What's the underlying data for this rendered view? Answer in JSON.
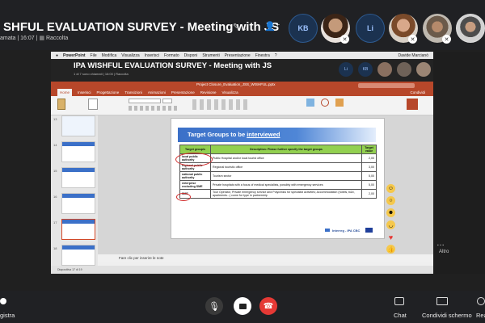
{
  "call": {
    "title": "SHFUL EVALUATION SURVEY - Meeting with JS",
    "subtitle_prefix": "amata | 16:07 |",
    "subtitle_group": "Raccolta"
  },
  "participants": [
    {
      "initials": "KB"
    },
    {
      "initials": "Li"
    }
  ],
  "shared": {
    "menubar": [
      "PowerPoint",
      "File",
      "Modifica",
      "Visualizza",
      "Inserisci",
      "Formato",
      "Disponi",
      "Strumenti",
      "Presentazione",
      "Finestra",
      "?"
    ],
    "menubar_clock": "Davide Marcianò",
    "inner_title": "IPA WISHFUL EVALUATION SURVEY - Meeting with JS",
    "inner_sub": "1 di 7 sono chiamati | 16:00 | Raccolta",
    "ppt_filename": "Project Closure_Evaluation_JSS_WISHFUL.pptx",
    "ppt_tabs": [
      "Home",
      "Inserisci",
      "Progettazione",
      "Transizioni",
      "Animazioni",
      "Presentazione",
      "Revisione",
      "Visualizza"
    ],
    "share_label": "Condividi",
    "thumb_numbers": [
      "13",
      "14",
      "15",
      "16",
      "17",
      "18"
    ],
    "notes_text": "Fare clic per inserire le note",
    "status_text": "Diapositiva 17 di 19"
  },
  "slide": {
    "title_plain": "Target Groups to be ",
    "title_underlined": "interviewed",
    "headers": [
      "Target group/s",
      "Description: Please further specify the target groups",
      "Target value"
    ],
    "rows": [
      {
        "group": "local public authority",
        "desc": "Public Hospital and/or local tourist office",
        "value": "2,00"
      },
      {
        "group": "regional public authority",
        "desc": "Regional touristic office",
        "value": "3,00"
      },
      {
        "group": "national public authority",
        "desc": "Tourism sector",
        "value": "5,00"
      },
      {
        "group": "enterprise excluding SME",
        "desc": "Private hospitals with a focus of medical specialists, possibly with emergency services",
        "value": "5,00"
      },
      {
        "group": "SME",
        "desc": "Tour Operator, Private emergency service and Polyclinics for specialist activities; Accommodation (hotels, b&b, apartments...) come for type in partnership",
        "value": "2,00"
      }
    ],
    "footer_logo": "Interreg - IPA CBC"
  },
  "right_panel": {
    "more_label": "Altro"
  },
  "toolbar": {
    "left_label": "gistra",
    "chat_label": "Chat",
    "share_label": "Condividi schermo",
    "react_label": "Rea"
  },
  "colors": {
    "accent_blue": "#3b70c8",
    "ppt_red": "#b7472a",
    "table_green": "#92d050",
    "hangup_red": "#e53935"
  }
}
